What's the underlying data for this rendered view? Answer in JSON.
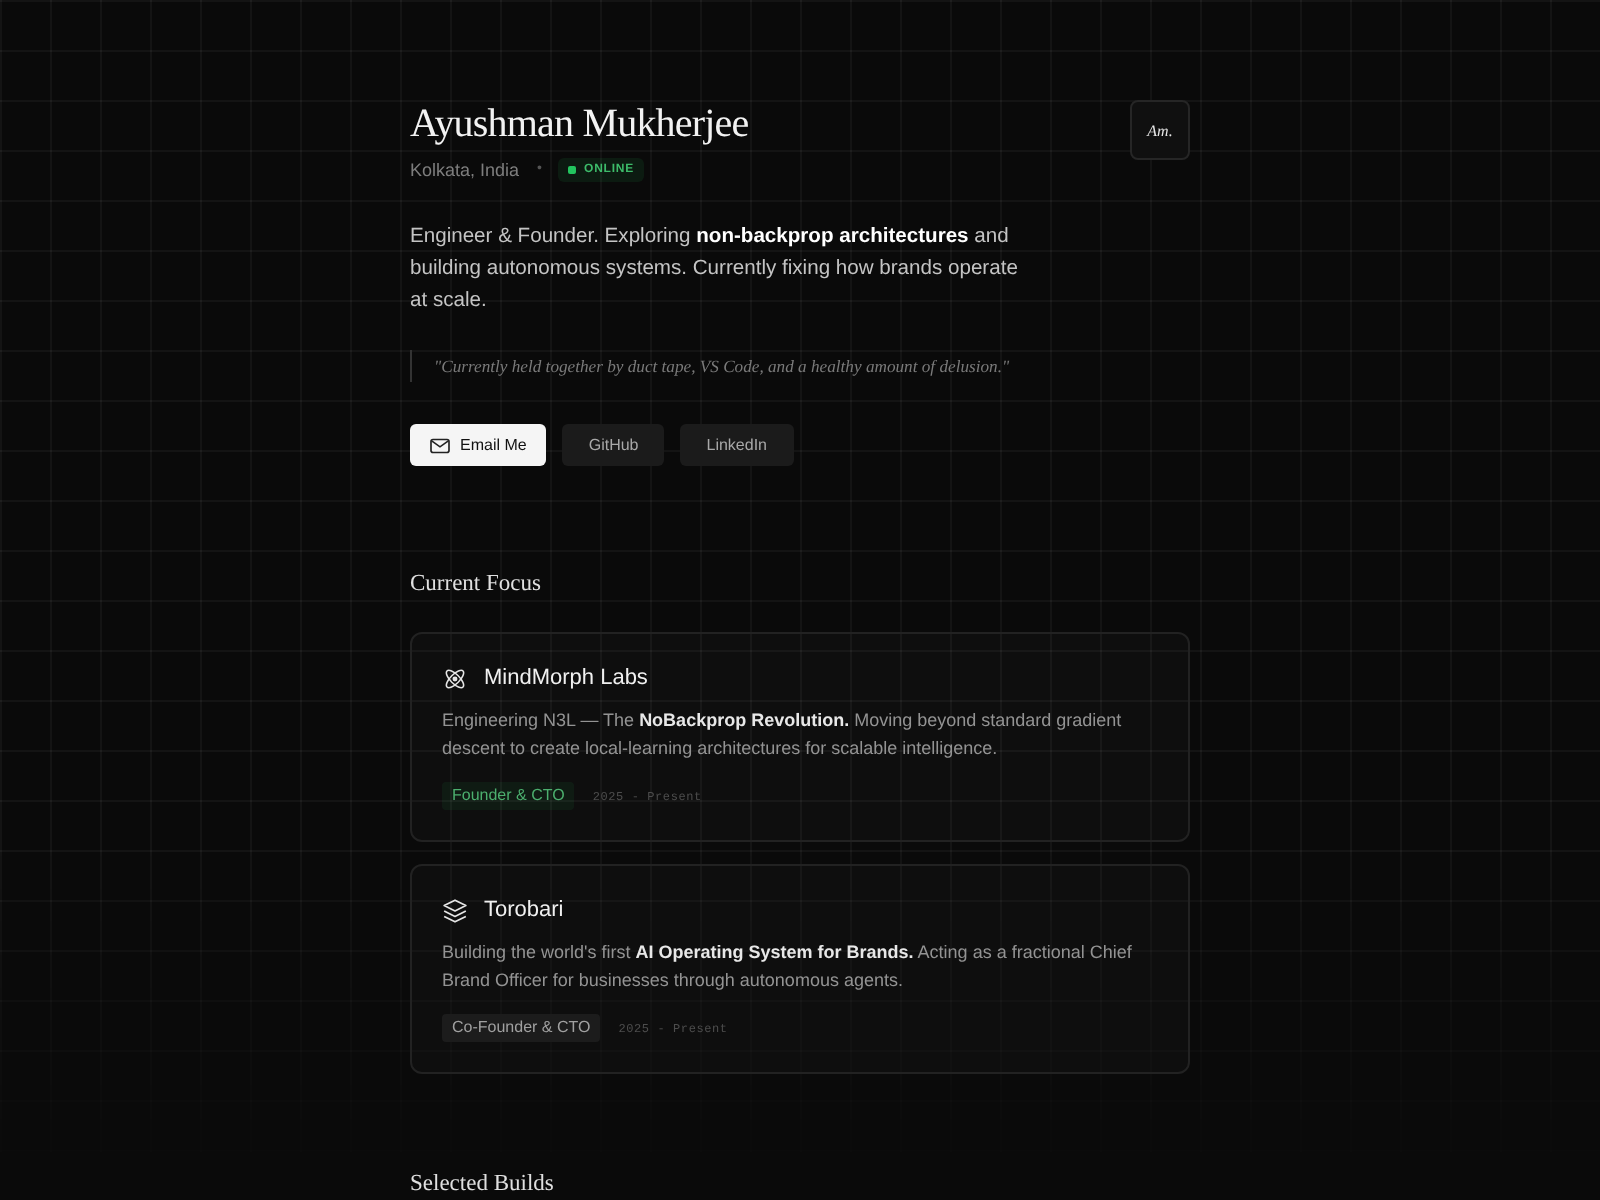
{
  "header": {
    "name": "Ayushman Mukherjee",
    "location": "Kolkata, India",
    "separator": "•",
    "status": {
      "label": "ONLINE",
      "online": true
    },
    "monogram": "Am."
  },
  "bio": "Engineer & Founder. Exploring **non-backprop architectures** and building autonomous systems. Currently fixing how brands operate at scale.",
  "quote": "\"Currently held together by duct tape, VS Code, and a healthy amount of delusion.\"",
  "buttons": [
    {
      "label": "Email Me",
      "kind": "primary",
      "icon": true
    },
    {
      "label": "GitHub",
      "kind": "secondary",
      "icon": false
    },
    {
      "label": "LinkedIn",
      "kind": "secondary",
      "icon": false
    }
  ],
  "sections": [
    {
      "title": "Current Focus",
      "cards": [
        {
          "kind": "lab",
          "title": "MindMorph Labs",
          "description": "Engineering N3L — The **NoBackprop Revolution.** Moving beyond standard gradient descent to create local-learning architectures for scalable intelligence.",
          "role": {
            "label": "Founder & CTO",
            "highlighted": true
          },
          "period": "2025 - Present"
        },
        {
          "kind": "company",
          "title": "Torobari",
          "description": "Building the world's first **AI Operating System for Brands.** Acting as a fractional Chief Brand Officer for businesses through autonomous agents.",
          "role": {
            "label": "Co-Founder & CTO",
            "highlighted": false
          },
          "period": "2025 - Present"
        }
      ]
    },
    {
      "title": "Selected Builds"
    }
  ]
}
